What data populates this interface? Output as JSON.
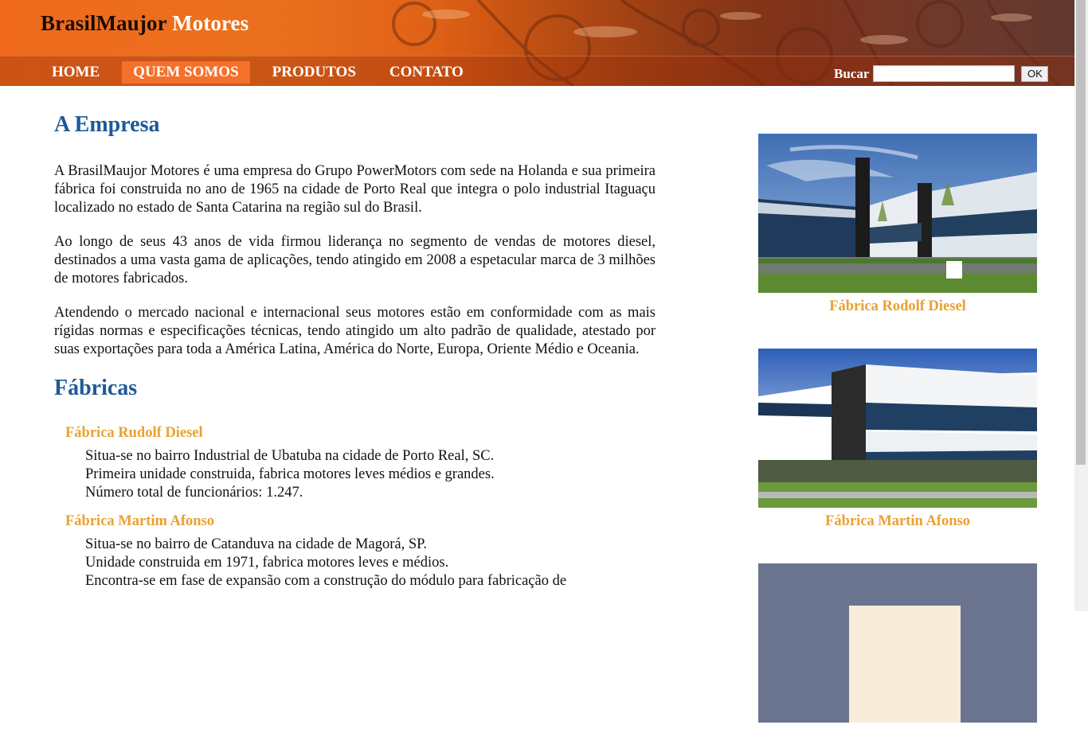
{
  "brand": {
    "part1": "BrasilMaujor",
    "part2": "Motores"
  },
  "nav": [
    {
      "label": "HOME"
    },
    {
      "label": "QUEM SOMOS",
      "active": true
    },
    {
      "label": "PRODUTOS"
    },
    {
      "label": "CONTATO"
    }
  ],
  "search": {
    "label": "Bucar",
    "value": "",
    "button": "OK"
  },
  "company": {
    "title": "A Empresa",
    "paragraphs": [
      "A BrasilMaujor Motores é uma empresa do Grupo PowerMotors com sede na Holanda e sua primeira fábrica foi construida no ano de 1965 na cidade de Porto Real que integra o polo industrial Itaguaçu localizado no estado de Santa Catarina na região sul do Brasil.",
      "Ao longo de seus 43 anos de vida firmou liderança no segmento de vendas de motores diesel, destinados a uma vasta gama de aplicações, tendo atingido em 2008 a espetacular marca de 3 milhões de motores fabricados.",
      "Atendendo o mercado nacional e internacional seus motores estão em conformidade com as mais rígidas normas e especificações técnicas, tendo atingido um alto padrão de qualidade, atestado por suas exportações para toda a América Latina, América do Norte, Europa, Oriente Médio e Oceania."
    ]
  },
  "factories": {
    "title": "Fábricas",
    "items": [
      {
        "name": "Fábrica Rudolf Diesel",
        "lines": [
          "Situa-se no bairro Industrial de Ubatuba na cidade de Porto Real, SC.",
          "Primeira unidade construida, fabrica motores leves médios e grandes.",
          "Número total de funcionários: 1.247."
        ]
      },
      {
        "name": "Fábrica Martim Afonso",
        "lines": [
          "Situa-se no bairro de Catanduva na cidade de Magorá, SP.",
          "Unidade construida em 1971, fabrica motores leves e médios.",
          "Encontra-se em fase de expansão com a construção do módulo para fabricação de"
        ]
      }
    ]
  },
  "sidebar": {
    "photos": [
      {
        "caption": "Fábrica Rodolf Diesel"
      },
      {
        "caption": "Fábrica Martin Afonso"
      },
      {
        "caption": ""
      }
    ]
  },
  "colors": {
    "heading": "#1d5a96",
    "accent": "#e9a132",
    "nav_active": "#f5702a",
    "header_orange": "#ef6a1c"
  }
}
